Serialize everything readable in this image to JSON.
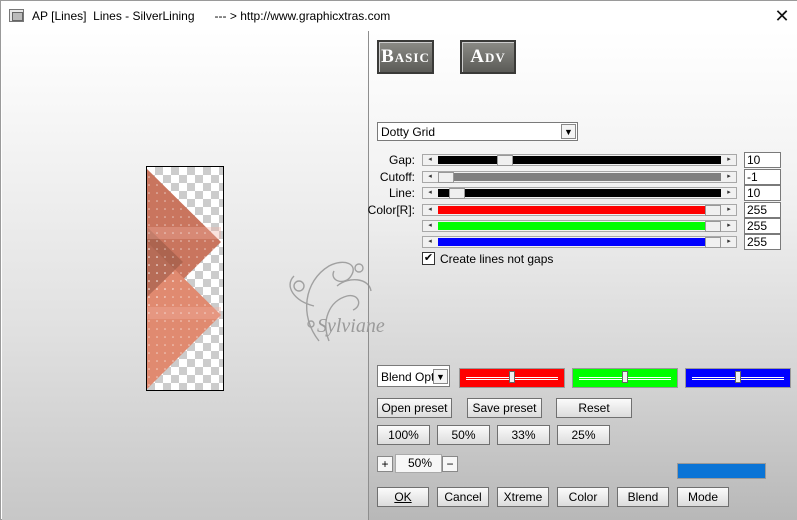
{
  "window": {
    "title": "AP [Lines]  Lines - SilverLining      --- > http://www.graphicxtras.com",
    "close_glyph": "✕"
  },
  "tabs": {
    "basic": "Basic",
    "adv": "Adv"
  },
  "effect_select": {
    "value": "Dotty Grid"
  },
  "sliders": [
    {
      "label": "Gap:",
      "value": "10",
      "level": 0.22,
      "track_color": "#000000"
    },
    {
      "label": "Cutoff:",
      "value": "-1",
      "level": 0.0,
      "track_color": "#808080"
    },
    {
      "label": "Line:",
      "value": "10",
      "level": 0.04,
      "track_color": "#000000"
    },
    {
      "label": "Color[R]:",
      "value": "255",
      "level": 1.0,
      "track_color": "#ff0000"
    },
    {
      "label": "",
      "value": "255",
      "level": 1.0,
      "track_color": "#00ff00"
    },
    {
      "label": "",
      "value": "255",
      "level": 1.0,
      "track_color": "#0000ff"
    }
  ],
  "create_lines_checkbox": {
    "label": "Create lines not gaps",
    "checked": true,
    "check_glyph": "✔"
  },
  "blend_select": {
    "value": "Blend Optio"
  },
  "channel_boxes": [
    {
      "color": "#ff0000",
      "level": 0.5
    },
    {
      "color": "#00ff00",
      "level": 0.5
    },
    {
      "color": "#0000ff",
      "level": 0.5
    }
  ],
  "preset_buttons": {
    "open": "Open preset",
    "save": "Save preset",
    "reset": "Reset"
  },
  "zoom_buttons": [
    "100%",
    "50%",
    "33%",
    "25%"
  ],
  "zoom_control": {
    "plus": "+",
    "value": "50%",
    "minus": "−"
  },
  "preview_color": "#0a74d6",
  "bottom_buttons": {
    "ok": "OK",
    "cancel": "Cancel",
    "xtreme": "Xtreme",
    "color": "Color",
    "blend": "Blend",
    "mode": "Mode"
  },
  "watermark": "Sylviane",
  "preview_image": {
    "fill_top": "#b86a55",
    "fill_bottom": "#e0876c"
  }
}
